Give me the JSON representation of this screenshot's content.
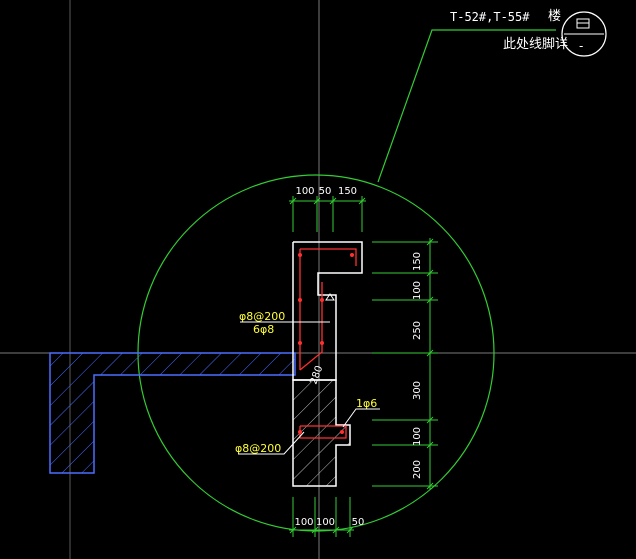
{
  "colors": {
    "background": "#000000",
    "crosshair": "#7a7a7a",
    "detail_circle": "#33cc33",
    "dimension": "#33cc33",
    "section_outline": "#ffffff",
    "rebar": "#ff3030",
    "rebar_label": "#ffff33",
    "slab_hatch": "#4a6dff",
    "hatch_gray": "#bdbdbd",
    "text": "#ffffff"
  },
  "title_block": {
    "sheet_ref": "T-52#,T-55#",
    "floor_label": "楼",
    "note": "此处线脚详",
    "bubble_top_icon": "detail-bubble-icon",
    "bubble_bottom": "-"
  },
  "top_dimensions": [
    "100",
    "50",
    "150"
  ],
  "bottom_dimensions": [
    "100",
    "100",
    "50"
  ],
  "right_dimensions": [
    "150",
    "100",
    "250",
    "300",
    "100",
    "200"
  ],
  "inner_dimension": "280",
  "rebar_labels": {
    "stirrup_upper": "φ8@200",
    "long_bars": "6φ8",
    "stirrup_lower": "φ8@200",
    "bottom_bar": "1φ6"
  }
}
